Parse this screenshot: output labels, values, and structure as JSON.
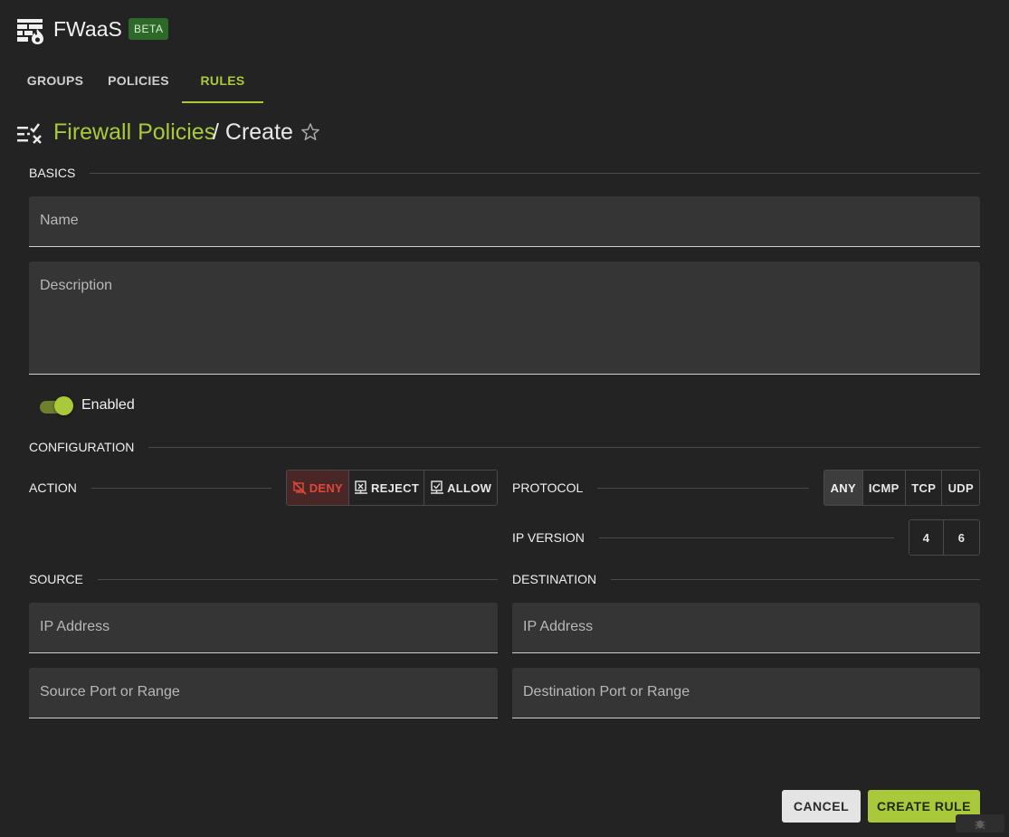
{
  "app": {
    "title": "FWaaS",
    "badge": "BETA"
  },
  "tabs": [
    {
      "label": "GROUPS"
    },
    {
      "label": "POLICIES"
    },
    {
      "label": "RULES",
      "active": true
    }
  ],
  "breadcrumb": {
    "parent": "Firewall Policies",
    "current": "/ Create"
  },
  "sections": {
    "basics": "BASICS",
    "configuration": "CONFIGURATION",
    "action": "ACTION",
    "protocol": "PROTOCOL",
    "ip_version": "IP VERSION",
    "source": "SOURCE",
    "destination": "DESTINATION"
  },
  "fields": {
    "name": {
      "placeholder": "Name",
      "value": ""
    },
    "description": {
      "placeholder": "Description",
      "value": ""
    },
    "source_ip": {
      "placeholder": "IP Address",
      "value": ""
    },
    "source_port": {
      "placeholder": "Source Port or Range",
      "value": ""
    },
    "dest_ip": {
      "placeholder": "IP Address",
      "value": ""
    },
    "dest_port": {
      "placeholder": "Destination Port or Range",
      "value": ""
    }
  },
  "toggle": {
    "label": "Enabled",
    "on": true
  },
  "action_options": [
    {
      "label": "DENY",
      "icon": "deny-icon",
      "selected": true
    },
    {
      "label": "REJECT",
      "icon": "reject-icon",
      "selected": false
    },
    {
      "label": "ALLOW",
      "icon": "allow-icon",
      "selected": false
    }
  ],
  "protocol_options": [
    {
      "label": "ANY",
      "selected": true
    },
    {
      "label": "ICMP",
      "selected": false
    },
    {
      "label": "TCP",
      "selected": false
    },
    {
      "label": "UDP",
      "selected": false
    }
  ],
  "ip_version_options": [
    {
      "label": "4",
      "selected": false
    },
    {
      "label": "6",
      "selected": false
    }
  ],
  "footer": {
    "cancel": "CANCEL",
    "create": "CREATE RULE"
  },
  "colors": {
    "accent": "#a9c93a",
    "deny": "#e0483c",
    "background": "#232323",
    "field": "#353535"
  }
}
